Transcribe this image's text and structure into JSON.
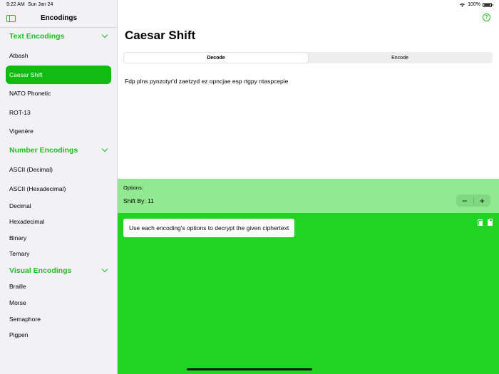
{
  "status_bar": {
    "time": "9:22 AM",
    "date": "Sun Jan 24",
    "battery": "100%",
    "icons": [
      "wifi-icon",
      "battery-icon"
    ]
  },
  "sidebar": {
    "title": "Encodings",
    "sections": [
      {
        "label": "Text Encodings",
        "items": [
          "Atbash",
          "Caesar Shift",
          "NATO Phonetic",
          "ROT-13",
          "Vigenère"
        ]
      },
      {
        "label": "Number Encodings",
        "items": [
          "ASCII (Decimal)",
          "ASCII (Hexadecimal)",
          "Decimal",
          "Hexadecimal",
          "Binary",
          "Ternary"
        ]
      },
      {
        "label": "Visual Encodings",
        "items": [
          "Braille",
          "Morse",
          "Semaphore",
          "Pigpen"
        ]
      }
    ],
    "selected": "Caesar Shift"
  },
  "main": {
    "help_icon": "?",
    "title": "Caesar Shift",
    "tabs": [
      "Decode",
      "Encode"
    ],
    "active_tab": "Decode",
    "ciphertext": "Fdp plns pynzotyr'd zaetzyd ez opncjae esp rtgpy ntaspcepie",
    "options_label": "Options:",
    "shift_label": "Shift By: 11",
    "stepper_minus": "−",
    "stepper_plus": "+",
    "tip": "Use each encoding's options to decrypt the given ciphertext"
  },
  "colors": {
    "accent": "#22bb22",
    "selected": "#11bb11",
    "options_bg": "#91e991",
    "result_bg": "#22d422"
  }
}
